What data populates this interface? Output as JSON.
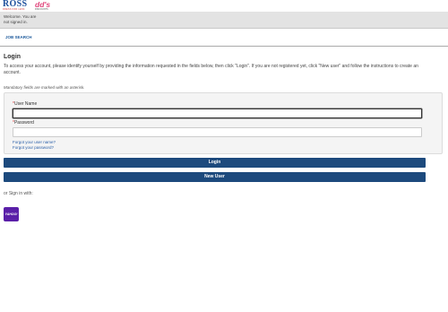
{
  "header": {
    "ross_logo": {
      "word": "ROSS",
      "tag": "DRESS FOR LESS"
    },
    "dds_logo": {
      "word": "dd's",
      "tag": "DISCOUNTS"
    }
  },
  "welcome": {
    "line1": "Welcome. You are",
    "line2": "not signed in."
  },
  "nav": {
    "job_search": "JOB SEARCH"
  },
  "login": {
    "title": "Login",
    "intro": "To access your account, please identify yourself by providing the information requested in the fields below, then click \"Login\". If you are not registered yet, click \"New user\" and follow the instructions to create an account.",
    "mandatory_note": "Mandatory fields are marked with an asterisk.",
    "asterisk": "*",
    "username_label": "User Name",
    "username_value": "",
    "password_label": "Password",
    "password_value": "",
    "forgot_username": "Forgot your user name?",
    "forgot_password": "Forgot your password?",
    "login_button": "Login",
    "new_user_button": "New User",
    "signin_with": "or Sign in with:",
    "yahoo_label": "YAHOO!"
  },
  "colors": {
    "button": "#1d4a7d",
    "yahoo": "#5a1fa8",
    "link": "#2a5fa8"
  },
  "icons": {
    "yahoo": "yahoo-logo-icon"
  }
}
